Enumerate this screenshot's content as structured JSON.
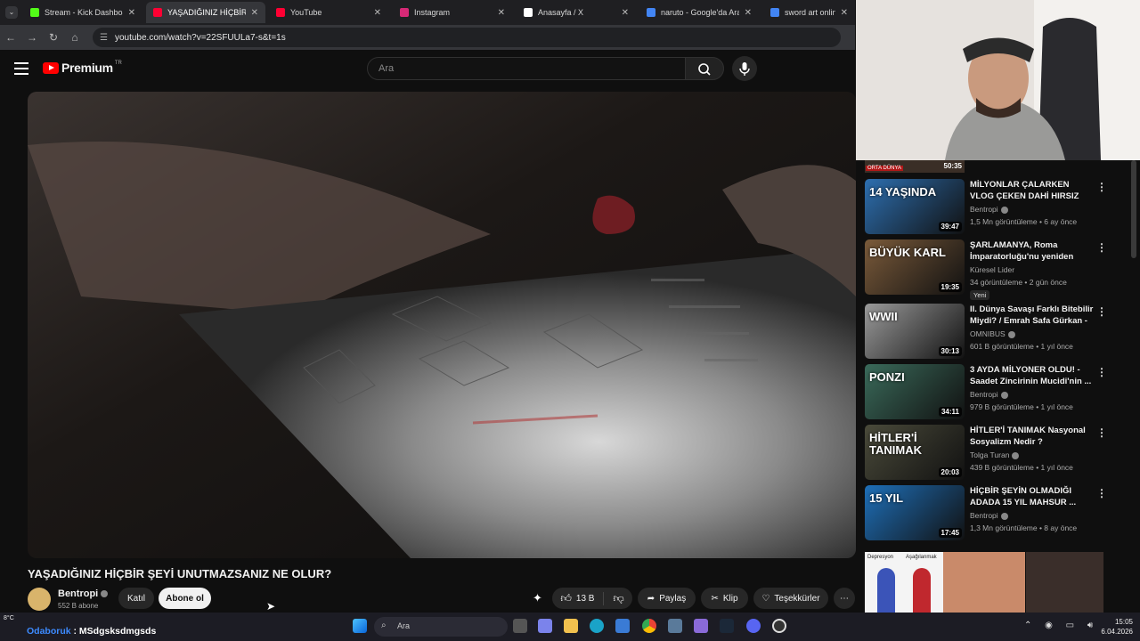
{
  "browser": {
    "tabs": [
      {
        "title": "Stream - Kick Dashboard",
        "fav": "#53fc18",
        "active": false
      },
      {
        "title": "YAŞADIĞINIZ HİÇBİR",
        "fav": "#ff0033",
        "active": true
      },
      {
        "title": "YouTube",
        "fav": "#ff0033",
        "active": false
      },
      {
        "title": "Instagram",
        "fav": "#d62976",
        "active": false
      },
      {
        "title": "Anasayfa / X",
        "fav": "#ffffff",
        "active": false
      },
      {
        "title": "naruto - Google'da Ara",
        "fav": "#4285f4",
        "active": false
      },
      {
        "title": "sword art online - Goo",
        "fav": "#4285f4",
        "active": false
      }
    ],
    "url": "youtube.com/watch?v=22SFUULa7-s&t=1s"
  },
  "header": {
    "logo_text": "Premium",
    "logo_region": "TR",
    "search_placeholder": "Ara"
  },
  "video": {
    "title": "YAŞADIĞINIZ HİÇBİR ŞEYİ UNUTMAZSANIZ NE OLUR?",
    "channel": "Bentropi",
    "subscribers": "552 B abone",
    "join_label": "Katıl",
    "subscribe_label": "Abone ol",
    "likes": "13 B",
    "share_label": "Paylaş",
    "clip_label": "Klip",
    "thanks_label": "Teşekkürler"
  },
  "recommendations": [
    {
      "title": "MİLYONLAR ÇALARKEN VLOG ÇEKEN DAHİ HIRSIZ",
      "channel": "Bentropi",
      "verified": true,
      "meta": "1,5 Mn görüntüleme • 6 ay önce",
      "duration": "39:47",
      "thumb": "#2d6fb0",
      "overlay": "14 YAŞINDA"
    },
    {
      "title": "ŞARLAMANYA, Roma İmparatorluğu'nu yeniden kura...",
      "channel": "Küresel Lider",
      "verified": false,
      "meta": "34 görüntüleme • 2 gün önce",
      "duration": "19:35",
      "thumb": "#7a5a3a",
      "overlay": "BÜYÜK KARL",
      "badge": "Yeni"
    },
    {
      "title": "II. Dünya Savaşı Farklı Bitebilir Miydi? / Emrah Safa Gürkan - ...",
      "channel": "OMNIBUS",
      "verified": true,
      "meta": "601 B görüntüleme • 1 yıl önce",
      "duration": "30:13",
      "thumb": "#9a9a9a",
      "overlay": "WWII"
    },
    {
      "title": "3 AYDA MİLYONER OLDU! - Saadet Zincirinin Mucidi'nin ...",
      "channel": "Bentropi",
      "verified": true,
      "meta": "979 B görüntüleme • 1 yıl önce",
      "duration": "34:11",
      "thumb": "#3a6a5a",
      "overlay": "PONZI"
    },
    {
      "title": "HİTLER'İ TANIMAK Nasyonal Sosyalizm Nedir ?",
      "channel": "Tolga Turan",
      "verified": true,
      "meta": "439 B görüntüleme • 1 yıl önce",
      "duration": "20:03",
      "thumb": "#4a4a3a",
      "overlay": "HİTLER'İ TANIMAK"
    },
    {
      "title": "HİÇBİR ŞEYİN OLMADIĞI ADADA 15 YIL MAHSUR ...",
      "channel": "Bentropi",
      "verified": true,
      "meta": "1,3 Mn görüntüleme • 8 ay önce",
      "duration": "17:45",
      "thumb": "#1e6fb8",
      "overlay": "15 YIL"
    }
  ],
  "prev_item": {
    "duration": "50:35",
    "label": "ORTA DÜNYA"
  },
  "stripe": {
    "left_labels": [
      "Depresyon",
      "Aşağılanmak"
    ]
  },
  "taskbar": {
    "weather": "8°C",
    "ticker_prefix": "Odaboruk",
    "ticker_text": " : MSdgsksdmgsds",
    "search": "Ara",
    "time": "15:05",
    "date": "6.04.2026"
  }
}
